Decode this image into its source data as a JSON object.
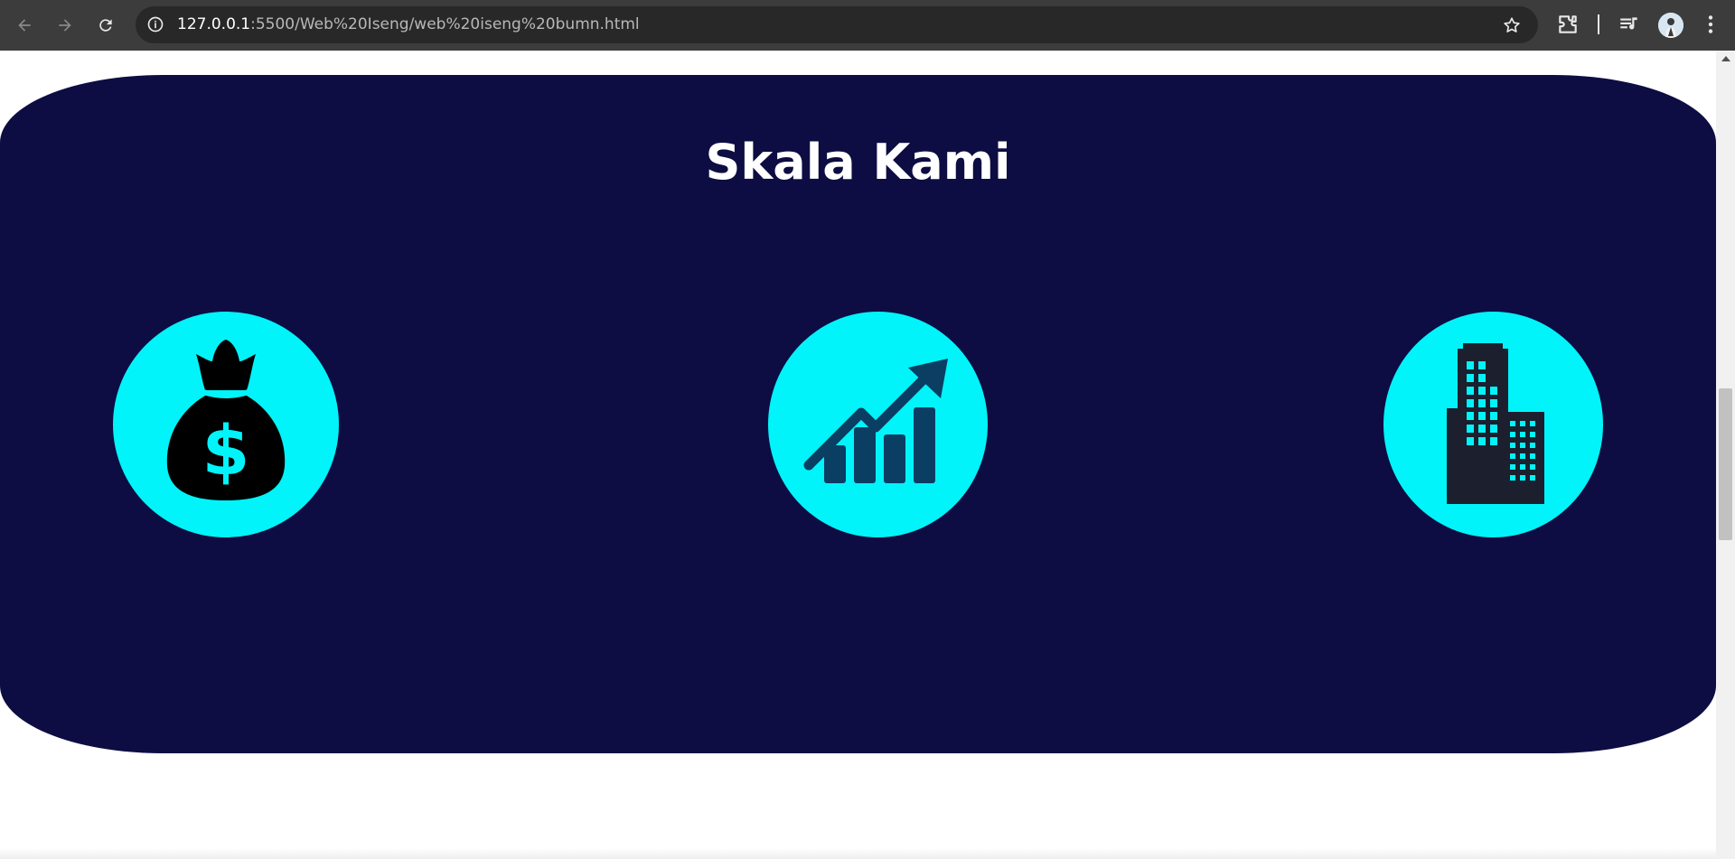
{
  "browser": {
    "url_host": "127.0.0.1",
    "url_rest": ":5500/Web%20Iseng/web%20iseng%20bumn.html",
    "icons": [
      "back-icon",
      "forward-icon",
      "reload-icon",
      "site-info-icon",
      "bookmark-star-icon",
      "extensions-icon",
      "media-controls-icon",
      "profile-avatar",
      "menu-kebab-icon"
    ]
  },
  "section": {
    "title": "Skala Kami",
    "background": "#0d0d43",
    "accent": "#00f4f9",
    "stats": [
      {
        "icon": "money-bag-icon"
      },
      {
        "icon": "growth-chart-icon"
      },
      {
        "icon": "office-building-icon"
      }
    ]
  }
}
